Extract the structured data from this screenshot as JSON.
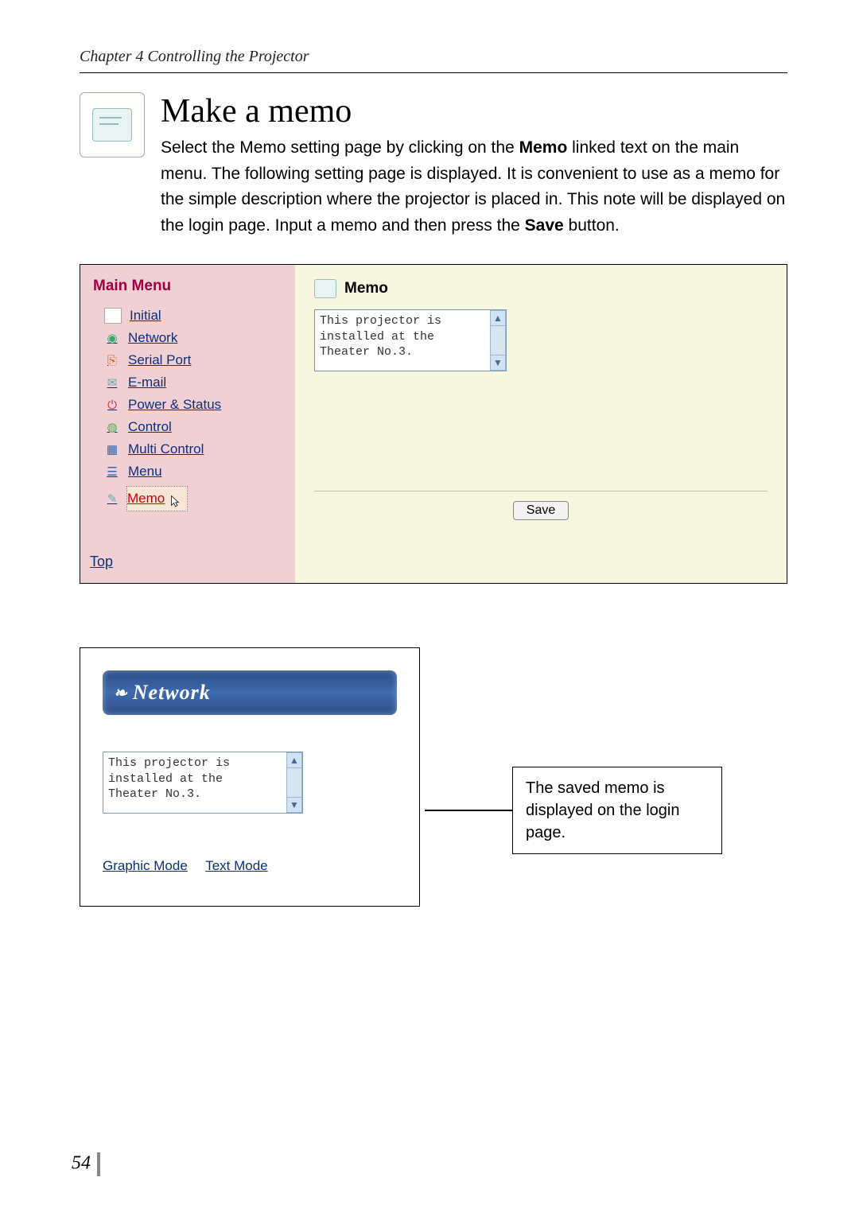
{
  "chapter": "Chapter 4 Controlling the Projector",
  "title": "Make a memo",
  "intro_parts": {
    "p1a": "Select the Memo setting page by clicking on the ",
    "memo_word": "Memo",
    "p1b": " linked text on the main menu. The following setting page is displayed. It is convenient to use as a memo for the simple description where the projector is placed in. This note will be displayed on the login page. Input a memo and then press the ",
    "save_word": "Save",
    "p1c": " button."
  },
  "screenshot1": {
    "sidebar_title": "Main Menu",
    "menu": [
      {
        "label": "Initial",
        "icon": "doc"
      },
      {
        "label": "Network",
        "icon": "net"
      },
      {
        "label": "Serial Port",
        "icon": "serial"
      },
      {
        "label": "E-mail",
        "icon": "mail"
      },
      {
        "label": "Power & Status",
        "icon": "power"
      },
      {
        "label": "Control",
        "icon": "ctrl"
      },
      {
        "label": "Multi Control",
        "icon": "multi"
      },
      {
        "label": "Menu",
        "icon": "menu"
      }
    ],
    "active": {
      "label": "Memo",
      "icon": "memo"
    },
    "top_link": "Top",
    "pane_title": "Memo",
    "memo_text": "This projector is\ninstalled at the\nTheater No.3.",
    "save_label": "Save"
  },
  "screenshot2": {
    "banner": "Network",
    "memo_text": "This projector is\ninstalled at the\nTheater No.3.",
    "modes": {
      "graphic": "Graphic Mode",
      "text": "Text Mode"
    },
    "callout": "The saved memo is displayed on the login page."
  },
  "page_number": "54"
}
